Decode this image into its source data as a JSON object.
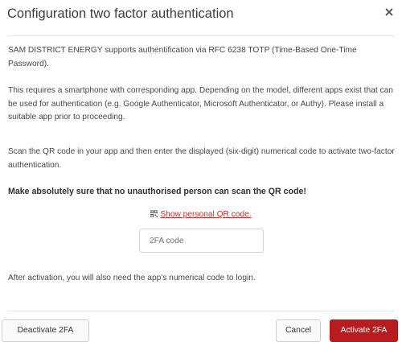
{
  "dialog": {
    "title": "Configuration two factor authentication",
    "paragraphs": {
      "intro": "SAM DISTRICT ENERGY supports authentification via RFC 6238 TOTP (Time-Based One-Time Password).",
      "requirements": "This requires a smartphone with corresponding app. Depending on the model, different apps exist that can be used for authentication (e.g. Google Authenticator, Microsoft Authenticator, or Authy). Please install a suitable app prior to proceeding.",
      "scan": "Scan the QR code in your app and then enter the displayed (six-digit) numerical code to activate two-factor authentication.",
      "warning": "Make absolutely sure that no unauthorised person can scan the QR code!",
      "after": "After activation, you will also need the app's numerical code to login."
    },
    "qr_link_label": "Show personal QR code.",
    "code_input": {
      "placeholder": "2FA code",
      "value": ""
    },
    "buttons": {
      "deactivate": "Deactivate 2FA",
      "cancel": "Cancel",
      "activate": "Activate 2FA"
    },
    "icons": {
      "close": "close-icon",
      "qr": "qr-code-icon"
    },
    "colors": {
      "accent": "#b81c1f",
      "link": "#c9302c"
    }
  }
}
